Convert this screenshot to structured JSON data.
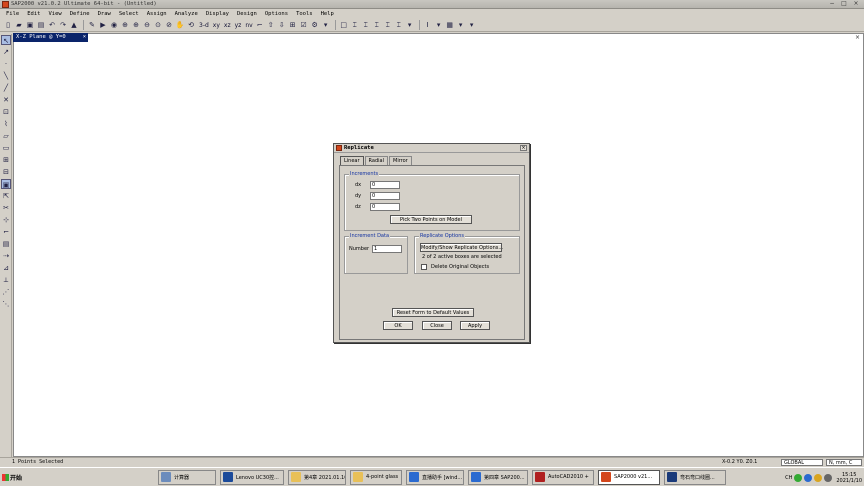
{
  "window": {
    "title": "SAP2000 v21.0.2 Ultimate 64-bit - (Untitled)",
    "controls": [
      "−",
      "□",
      "×"
    ]
  },
  "menu": [
    "File",
    "Edit",
    "View",
    "Define",
    "Draw",
    "Select",
    "Assign",
    "Analyze",
    "Display",
    "Design",
    "Options",
    "Tools",
    "Help"
  ],
  "toolbar": {
    "view_buttons": [
      "3-d",
      "xy",
      "xz",
      "yz",
      "nv"
    ]
  },
  "view_tab": {
    "label": "X-Z Plane @ Y=0",
    "close": "×"
  },
  "canvas_close": "×",
  "dialog": {
    "title": "Replicate",
    "close": "×",
    "tabs": [
      "Linear",
      "Radial",
      "Mirror"
    ],
    "selected_tab": "Linear",
    "increments": {
      "label": "Increments",
      "dx_label": "dx",
      "dx": "0",
      "dy_label": "dy",
      "dy": "0",
      "dz_label": "dz",
      "dz": "0",
      "pick_button": "Pick Two Points on Model"
    },
    "increment_data": {
      "label": "Increment Data",
      "number_label": "Number",
      "number": "1"
    },
    "replicate_options": {
      "label": "Replicate Options",
      "modify_button": "Modify/Show Replicate Options...",
      "status": "2 of 2 active boxes are selected",
      "delete_label": "Delete Original Objects",
      "delete_checked": false
    },
    "reset_button": "Reset Form to Default Values",
    "ok": "OK",
    "close_button": "Close",
    "apply": "Apply"
  },
  "status": {
    "left": "1 Points Selected",
    "coords": "X-0.2  Y0.  Z0.1",
    "coord_system": "GLOBAL",
    "units": "N, mm, C"
  },
  "taskbar": {
    "start": "开始",
    "tasks": [
      {
        "label": "计算器",
        "color": "#6c8cbc"
      },
      {
        "label": "Lenovo UC30控...",
        "color": "#1b4a9a"
      },
      {
        "label": "第4章 2021.01.10",
        "color": "#e8c058"
      },
      {
        "label": "4-point glass",
        "color": "#e8c058"
      },
      {
        "label": "直播助手 [wind...",
        "color": "#2a6ad0"
      },
      {
        "label": "第四章 SAP200...",
        "color": "#2a6ad0"
      },
      {
        "label": "AutoCAD2010 +",
        "color": "#b02020"
      },
      {
        "label": "SAP2000 v21...",
        "color": "#d4471c"
      },
      {
        "label": "弯石弯口线圈...",
        "color": "#1a3a7a"
      }
    ],
    "active_task": 7,
    "tray": {
      "lang": "CH",
      "time": "15:15",
      "date": "2021/1/10"
    }
  }
}
